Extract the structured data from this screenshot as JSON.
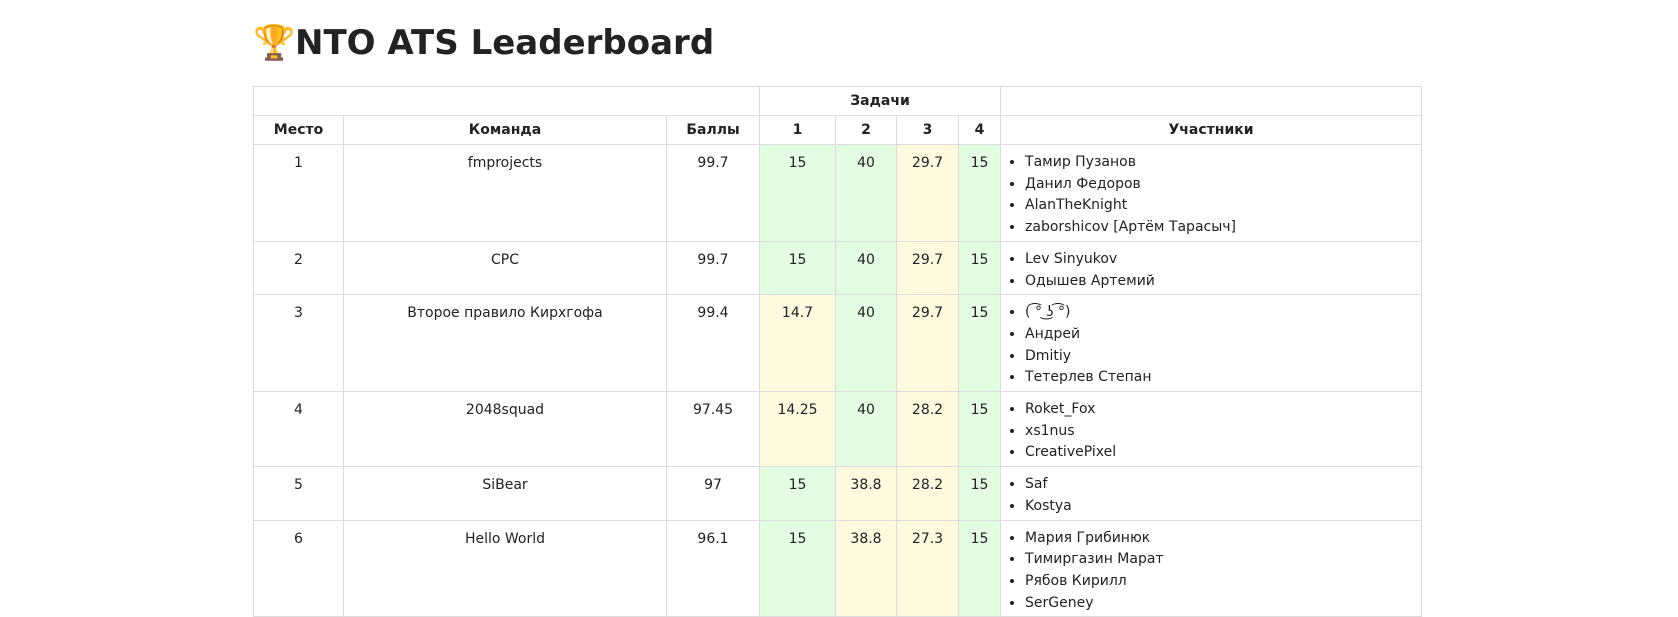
{
  "page": {
    "title": "NTO ATS Leaderboard",
    "trophy": "🏆"
  },
  "table": {
    "group_header": "Задачи",
    "headers": {
      "place": "Место",
      "team": "Команда",
      "score": "Баллы",
      "tasks": [
        "1",
        "2",
        "3",
        "4"
      ],
      "members": "Участники"
    },
    "rows": [
      {
        "place": "1",
        "team": "fmprojects",
        "score": "99.7",
        "tasks": [
          {
            "value": "15",
            "status": "full"
          },
          {
            "value": "40",
            "status": "full"
          },
          {
            "value": "29.7",
            "status": "partial"
          },
          {
            "value": "15",
            "status": "full"
          }
        ],
        "members": [
          "Тамир Пузанов",
          "Данил Федоров",
          "AlanTheKnight",
          "zaborshicov [Артём Тарасыч]"
        ]
      },
      {
        "place": "2",
        "team": "CPC",
        "score": "99.7",
        "tasks": [
          {
            "value": "15",
            "status": "full"
          },
          {
            "value": "40",
            "status": "full"
          },
          {
            "value": "29.7",
            "status": "partial"
          },
          {
            "value": "15",
            "status": "full"
          }
        ],
        "members": [
          "Lev Sinyukov",
          "Одышев Артемий"
        ]
      },
      {
        "place": "3",
        "team": "Второе правило Кирхгофа",
        "score": "99.4",
        "tasks": [
          {
            "value": "14.7",
            "status": "partial"
          },
          {
            "value": "40",
            "status": "full"
          },
          {
            "value": "29.7",
            "status": "partial"
          },
          {
            "value": "15",
            "status": "full"
          }
        ],
        "members": [
          "( ͡° ͜ʖ ͡°)",
          "Андрей",
          "Dmitiy",
          "Тетерлев Степан"
        ]
      },
      {
        "place": "4",
        "team": "2048squad",
        "score": "97.45",
        "tasks": [
          {
            "value": "14.25",
            "status": "partial"
          },
          {
            "value": "40",
            "status": "full"
          },
          {
            "value": "28.2",
            "status": "partial"
          },
          {
            "value": "15",
            "status": "full"
          }
        ],
        "members": [
          "Roket_Fox",
          "xs1nus",
          "CreativePixel"
        ]
      },
      {
        "place": "5",
        "team": "SiBear",
        "score": "97",
        "tasks": [
          {
            "value": "15",
            "status": "full"
          },
          {
            "value": "38.8",
            "status": "partial"
          },
          {
            "value": "28.2",
            "status": "partial"
          },
          {
            "value": "15",
            "status": "full"
          }
        ],
        "members": [
          "Saf",
          "Kostya"
        ]
      },
      {
        "place": "6",
        "team": "Hello World",
        "score": "96.1",
        "tasks": [
          {
            "value": "15",
            "status": "full"
          },
          {
            "value": "38.8",
            "status": "partial"
          },
          {
            "value": "27.3",
            "status": "partial"
          },
          {
            "value": "15",
            "status": "full"
          }
        ],
        "members": [
          "Мария Грибинюк",
          "Тимиргазин Марат",
          "Рябов Кирилл",
          "SerGeney"
        ]
      }
    ]
  },
  "colors": {
    "full_solve": "#e2fde2",
    "partial_solve": "#fdfae0",
    "border": "#dcdcdc"
  }
}
